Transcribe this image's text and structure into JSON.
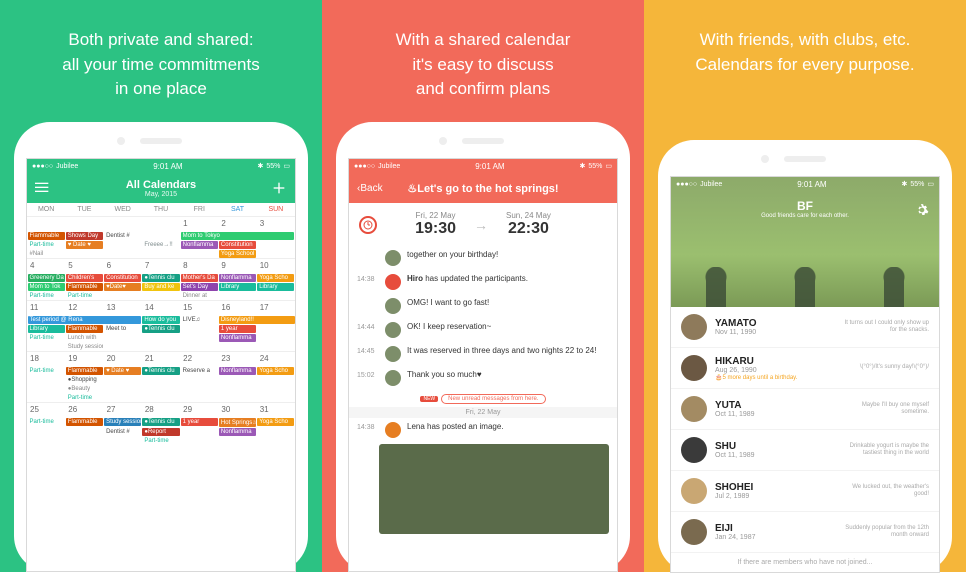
{
  "panels": {
    "green": {
      "tagline": [
        "Both private and shared:",
        "all your time commitments",
        "in one place"
      ],
      "status": {
        "carrier": "Jubilee",
        "time": "9:01 AM",
        "battery": "55%"
      },
      "nav": {
        "title": "All Calendars",
        "sub": "May, 2015"
      },
      "days": [
        "MON",
        "TUE",
        "WED",
        "THU",
        "FRI",
        "SAT",
        "SUN"
      ],
      "weeks": [
        {
          "nums": [
            "",
            "",
            "",
            "",
            "1",
            "2",
            "3"
          ],
          "rows": [
            [
              {
                "t": "Flammable",
                "c": "#d35400"
              },
              {
                "t": "Shows Day",
                "c": "#c0392b"
              },
              {
                "t": "Dentist #",
                "c": "",
                "txt": "#444"
              },
              {
                "t": "",
                "c": ""
              },
              {
                "t": "Mom to Tokyo",
                "c": "#2ecc71",
                "span": 3
              }
            ],
            [
              {
                "t": "Part-time",
                "txt": "#1abc9c"
              },
              {
                "t": "♥ Date ♥",
                "c": "#e67e22"
              },
              {
                "t": "",
                "c": ""
              },
              {
                "t": "Freeee→!!",
                "txt": "#7f8c8d"
              },
              {
                "t": "Nonflamma",
                "c": "#9b59b6"
              },
              {
                "t": "Constitution",
                "c": "#e74c3c"
              },
              {
                "t": "",
                "c": ""
              }
            ],
            [
              {
                "t": "#Nail",
                "txt": "#888"
              },
              {
                "t": "",
                "c": ""
              },
              {
                "t": "",
                "c": ""
              },
              {
                "t": "",
                "c": ""
              },
              {
                "t": "",
                "c": ""
              },
              {
                "t": "Yoga School",
                "c": "#f39c12"
              },
              {
                "t": "",
                "c": ""
              }
            ]
          ]
        },
        {
          "nums": [
            "4",
            "5",
            "6",
            "7",
            "8",
            "9",
            "10"
          ],
          "rows": [
            [
              {
                "t": "Greenery Da",
                "c": "#27ae60"
              },
              {
                "t": "Children's",
                "c": "#e74c3c"
              },
              {
                "t": "Constitution",
                "c": "#e74c3c"
              },
              {
                "t": "●Tennis clu",
                "c": "#16a085"
              },
              {
                "t": "Mother's Da",
                "c": "#e74c3c"
              },
              {
                "t": "Nonflamma",
                "c": "#9b59b6"
              },
              {
                "t": "Yoga Scho",
                "c": "#f39c12"
              }
            ],
            [
              {
                "t": "Mom to Tok",
                "c": "#2ecc71"
              },
              {
                "t": "Flammable",
                "c": "#d35400"
              },
              {
                "t": "♥Date♥",
                "c": "#e67e22"
              },
              {
                "t": "Buy and ke",
                "c": "#f1c40f"
              },
              {
                "t": "Set's Day",
                "c": "#8e44ad"
              },
              {
                "t": "Library",
                "c": "#1abc9c"
              },
              {
                "t": "Library",
                "c": "#1abc9c"
              }
            ],
            [
              {
                "t": "Part-time",
                "txt": "#1abc9c"
              },
              {
                "t": "Part-time",
                "txt": "#1abc9c"
              },
              {
                "t": "",
                "c": ""
              },
              {
                "t": "",
                "c": ""
              },
              {
                "t": "Dinner at",
                "txt": "#888"
              },
              {
                "t": "",
                "c": ""
              },
              {
                "t": "",
                "c": ""
              }
            ]
          ]
        },
        {
          "nums": [
            "11",
            "12",
            "13",
            "14",
            "15",
            "16",
            "17"
          ],
          "rows": [
            [
              {
                "t": "Test period @ Rena",
                "c": "#3498db",
                "span": 3
              },
              {
                "t": "How do you",
                "c": "#1abc9c"
              },
              {
                "t": "LIVE♫",
                "txt": "#444"
              },
              {
                "t": "Disneyland!!",
                "c": "#f39c12",
                "span": 2
              }
            ],
            [
              {
                "t": "Library",
                "c": "#1abc9c"
              },
              {
                "t": "Flammable",
                "c": "#d35400"
              },
              {
                "t": "Meet to",
                "txt": "#444"
              },
              {
                "t": "●Tennis clu",
                "c": "#16a085"
              },
              {
                "t": "",
                "c": ""
              },
              {
                "t": "1 year",
                "c": "#e74c3c"
              },
              {
                "t": "",
                "c": ""
              }
            ],
            [
              {
                "t": "Part-time",
                "txt": "#1abc9c"
              },
              {
                "t": "Lunch with",
                "txt": "#888"
              },
              {
                "t": "",
                "c": ""
              },
              {
                "t": "",
                "c": ""
              },
              {
                "t": "",
                "c": ""
              },
              {
                "t": "Nonflamma",
                "c": "#9b59b6"
              },
              {
                "t": "",
                "c": ""
              }
            ],
            [
              {
                "t": "",
                "c": ""
              },
              {
                "t": "Study session",
                "txt": "#888"
              },
              {
                "t": "",
                "c": ""
              },
              {
                "t": "",
                "c": ""
              },
              {
                "t": "",
                "c": ""
              },
              {
                "t": "",
                "c": ""
              },
              {
                "t": "",
                "c": ""
              }
            ]
          ]
        },
        {
          "nums": [
            "18",
            "19",
            "20",
            "21",
            "22",
            "23",
            "24"
          ],
          "rows": [
            [
              {
                "t": "Part-time",
                "txt": "#1abc9c"
              },
              {
                "t": "Flammable",
                "c": "#d35400"
              },
              {
                "t": "♥ Date ♥",
                "c": "#e67e22"
              },
              {
                "t": "●Tennis clu",
                "c": "#16a085"
              },
              {
                "t": "Reserve a",
                "txt": "#444"
              },
              {
                "t": "Nonflamma",
                "c": "#9b59b6"
              },
              {
                "t": "Yoga Scho",
                "c": "#f39c12"
              }
            ],
            [
              {
                "t": "",
                "c": ""
              },
              {
                "t": "●Shopping",
                "txt": "#444"
              },
              {
                "t": "",
                "c": ""
              },
              {
                "t": "",
                "c": ""
              },
              {
                "t": "",
                "c": ""
              },
              {
                "t": "",
                "c": ""
              },
              {
                "t": "",
                "c": ""
              }
            ],
            [
              {
                "t": "",
                "c": ""
              },
              {
                "t": "●Beauty",
                "txt": "#888"
              },
              {
                "t": "",
                "c": ""
              },
              {
                "t": "",
                "c": ""
              },
              {
                "t": "",
                "c": ""
              },
              {
                "t": "",
                "c": ""
              },
              {
                "t": "",
                "c": ""
              }
            ],
            [
              {
                "t": "",
                "c": ""
              },
              {
                "t": "Part-time",
                "txt": "#1abc9c"
              },
              {
                "t": "",
                "c": ""
              },
              {
                "t": "",
                "c": ""
              },
              {
                "t": "",
                "c": ""
              },
              {
                "t": "",
                "c": ""
              },
              {
                "t": "",
                "c": ""
              }
            ]
          ]
        },
        {
          "nums": [
            "25",
            "26",
            "27",
            "28",
            "29",
            "30",
            "31"
          ],
          "rows": [
            [
              {
                "t": "Part-time",
                "txt": "#1abc9c"
              },
              {
                "t": "Flammable",
                "c": "#d35400"
              },
              {
                "t": "Study session",
                "c": "#2980b9"
              },
              {
                "t": "●Tennis clu",
                "c": "#16a085"
              },
              {
                "t": "1 year",
                "c": "#e74c3c"
              },
              {
                "t": "Hot Springs♨",
                "c": "#e67e22"
              },
              {
                "t": "Yoga Scho",
                "c": "#f39c12"
              }
            ],
            [
              {
                "t": "",
                "c": ""
              },
              {
                "t": "",
                "c": ""
              },
              {
                "t": "Dentist #",
                "txt": "#444"
              },
              {
                "t": "●Report",
                "c": "#c0392b"
              },
              {
                "t": "",
                "c": ""
              },
              {
                "t": "Nonflamma",
                "c": "#9b59b6"
              },
              {
                "t": "",
                "c": ""
              }
            ],
            [
              {
                "t": "",
                "c": ""
              },
              {
                "t": "",
                "c": ""
              },
              {
                "t": "",
                "c": ""
              },
              {
                "t": "Part-time",
                "txt": "#1abc9c"
              },
              {
                "t": "",
                "c": ""
              },
              {
                "t": "",
                "c": ""
              },
              {
                "t": "",
                "c": ""
              }
            ]
          ]
        }
      ]
    },
    "coral": {
      "tagline": [
        "With a shared calendar",
        "it's easy to discuss",
        "and confirm plans"
      ],
      "status": {
        "carrier": "Jubilee",
        "time": "9:01 AM",
        "battery": "55%"
      },
      "nav": {
        "back": "Back",
        "title": "♨Let's go to the hot springs!"
      },
      "times": {
        "from_d": "Fri, 22 May",
        "from_t": "19:30",
        "to_d": "Sun, 24 May",
        "to_t": "22:30"
      },
      "messages": [
        {
          "time": "",
          "text": "together on your birthday!",
          "pre": "Let's go to the hot springs"
        },
        {
          "time": "14:38",
          "text": "Hiro has updated the participants.",
          "system": true
        },
        {
          "time": "",
          "text": "OMG! I want to go fast!"
        },
        {
          "time": "14:44",
          "text": "OK! I keep reservation~"
        },
        {
          "time": "14:45",
          "text": "It was reserved in three days and two nights 22 to 24!"
        },
        {
          "time": "15:02",
          "text": "Thank you so much♥"
        }
      ],
      "new_divider": "New unread messages from here.",
      "date_divider": "Fri, 22 May",
      "post": {
        "time": "14:38",
        "text": "Lena has posted an image."
      }
    },
    "amber": {
      "tagline": [
        "With friends, with clubs, etc.",
        "Calendars for every purpose."
      ],
      "status": {
        "carrier": "Jubilee",
        "time": "9:01 AM",
        "battery": "55%"
      },
      "cover": {
        "title": "BF",
        "sub": "Good friends care for each other."
      },
      "friends": [
        {
          "name": "YAMATO",
          "date": "Nov 11, 1990",
          "quote": "It turns out I could only show up for the snacks."
        },
        {
          "name": "HIKARU",
          "date": "Aug 26, 1990",
          "extra": "🎂5 more days until a birthday.",
          "quote": "\\(°0°)/It's sunny day!\\(°0°)/"
        },
        {
          "name": "YUTA",
          "date": "Oct 11, 1989",
          "quote": "Maybe I'll buy one myself sometime."
        },
        {
          "name": "SHU",
          "date": "Oct 11, 1989",
          "quote": "Drinkable yogurt is maybe the tastiest thing in the world"
        },
        {
          "name": "SHOHEI",
          "date": "Jul 2, 1989",
          "quote": "We lucked out, the weather's good!"
        },
        {
          "name": "EIJI",
          "date": "Jan 24, 1987",
          "quote": "Suddenly popular from the 12th month onward"
        }
      ],
      "footer": "If there are members who have not joined..."
    }
  }
}
